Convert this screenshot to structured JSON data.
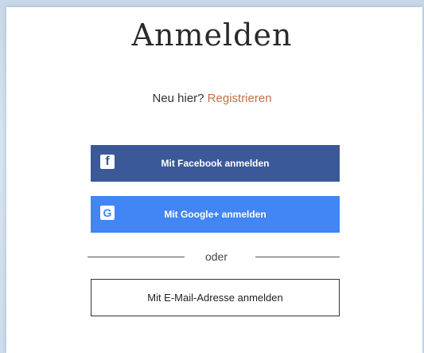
{
  "title": "Anmelden",
  "register": {
    "prompt": "Neu hier?",
    "link": "Registrieren"
  },
  "buttons": {
    "facebook": "Mit Facebook anmelden",
    "google": "Mit Google+ anmelden",
    "email": "Mit E-Mail-Adresse anmelden"
  },
  "icons": {
    "facebook": "f",
    "google": "G"
  },
  "divider": "oder",
  "colors": {
    "facebook": "#3b5998",
    "google": "#4285f4",
    "link": "#c0704b"
  }
}
